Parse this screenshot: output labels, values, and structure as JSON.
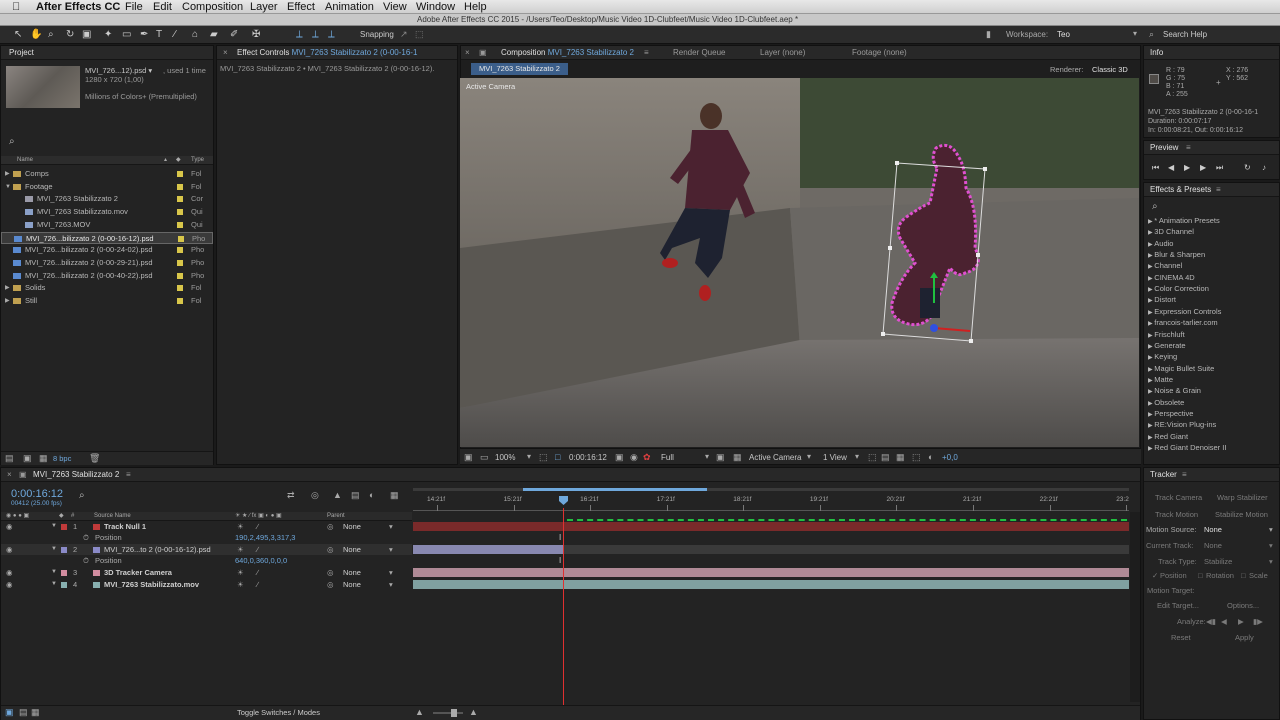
{
  "menubar": {
    "apple": "",
    "app": "After Effects CC",
    "items": [
      "File",
      "Edit",
      "Composition",
      "Layer",
      "Effect",
      "Animation",
      "View",
      "Window",
      "Help"
    ],
    "window_title": "Adobe After Effects CC 2015 - /Users/Teo/Desktop/Music Video 1D-Clubfeet/Music Video 1D-Clubfeet.aep *"
  },
  "toolbar": {
    "snapping": "Snapping",
    "workspace_label": "Workspace:",
    "workspace_value": "Teo",
    "search_help": "Search Help"
  },
  "project": {
    "title": "Project",
    "thumb_name": "MVI_726...12).psd ▾",
    "thumb_used": ", used 1 time",
    "thumb_dims": "1280 x 720 (1,00)",
    "thumb_colors": "Millions of Colors+ (Premultiplied)",
    "col_name": "Name",
    "col_type": "Type",
    "items": [
      {
        "indent": 0,
        "twirl": "▶",
        "icon": "folder",
        "name": "Comps",
        "type": "Fol"
      },
      {
        "indent": 0,
        "twirl": "▼",
        "icon": "folder",
        "name": "Footage",
        "type": "Fol"
      },
      {
        "indent": 1,
        "twirl": "",
        "icon": "comp",
        "name": "MVI_7263 Stabilizzato 2",
        "type": "Cor"
      },
      {
        "indent": 1,
        "twirl": "",
        "icon": "mov",
        "name": "MVI_7263 Stabilizzato.mov",
        "type": "Qui"
      },
      {
        "indent": 1,
        "twirl": "",
        "icon": "mov",
        "name": "MVI_7263.MOV",
        "type": "Qui"
      },
      {
        "indent": 0,
        "twirl": "",
        "icon": "psd",
        "name": "MVI_726...bilizzato 2 (0-00-16-12).psd",
        "type": "Pho",
        "selected": true
      },
      {
        "indent": 0,
        "twirl": "",
        "icon": "psd",
        "name": "MVI_726...bilizzato 2 (0-00-24-02).psd",
        "type": "Pho"
      },
      {
        "indent": 0,
        "twirl": "",
        "icon": "psd",
        "name": "MVI_726...bilizzato 2 (0-00-29-21).psd",
        "type": "Pho"
      },
      {
        "indent": 0,
        "twirl": "",
        "icon": "psd",
        "name": "MVI_726...bilizzato 2 (0-00-40-22).psd",
        "type": "Pho"
      },
      {
        "indent": 0,
        "twirl": "▶",
        "icon": "folder",
        "name": "Solids",
        "type": "Fol"
      },
      {
        "indent": 0,
        "twirl": "▶",
        "icon": "folder",
        "name": "Still",
        "type": "Fol"
      }
    ],
    "bpc": "8 bpc"
  },
  "effect_controls": {
    "tab_label": "Effect Controls",
    "tab_target": "MVI_7263 Stabilizzato 2 (0-00-16-1",
    "path": "MVI_7263 Stabilizzato 2 • MVI_7263 Stabilizzato 2 (0-00-16-12)."
  },
  "composition": {
    "tab_label": "Composition",
    "tab_target": "MVI_7263 Stabilizzato 2",
    "tab_render": "Render Queue",
    "tab_layer": "Layer (none)",
    "tab_footage": "Footage (none)",
    "subtab": "MVI_7263 Stabilizzato 2",
    "renderer_label": "Renderer:",
    "renderer_value": "Classic 3D",
    "viewer_label": "Active Camera",
    "zoom": "100%",
    "timecode": "0:00:16:12",
    "resolution": "Full",
    "camera": "Active Camera",
    "views": "1 View",
    "exposure": "+0,0"
  },
  "info": {
    "title": "Info",
    "r": "R : 79",
    "g": "G : 75",
    "b": "B : 71",
    "a": "A : 255",
    "x": "X : 276",
    "y": "Y : 562",
    "line1": "MVI_7263 Stabilizzato 2 (0-00-16-1",
    "line2": "Duration: 0:00:07:17",
    "line3": "In: 0:00:08:21, Out: 0:00:16:12"
  },
  "preview": {
    "title": "Preview"
  },
  "effects_presets": {
    "title": "Effects & Presets",
    "items": [
      "* Animation Presets",
      "3D Channel",
      "Audio",
      "Blur & Sharpen",
      "Channel",
      "CINEMA 4D",
      "Color Correction",
      "Distort",
      "Expression Controls",
      "francois-tarlier.com",
      "Frischluft",
      "Generate",
      "Keying",
      "Magic Bullet Suite",
      "Matte",
      "Noise & Grain",
      "Obsolete",
      "Perspective",
      "RE:Vision Plug-ins",
      "Red Giant",
      "Red Giant Denoiser II"
    ]
  },
  "timeline": {
    "tab": "MVI_7263 Stabilizzato 2",
    "timecode": "0:00:16:12",
    "frames": "00412 (25.00 fps)",
    "col_source": "Source Name",
    "col_parent": "Parent",
    "ruler": [
      "14:21f",
      "15:21f",
      "16:21f",
      "17:21f",
      "18:21f",
      "19:21f",
      "20:21f",
      "21:21f",
      "22:21f",
      "23:2"
    ],
    "layers": [
      {
        "num": "1",
        "name": "Track Null 1",
        "color": "#c03a3a",
        "parent": "None",
        "prop": "Position",
        "value": "190,2,495,3,317,3"
      },
      {
        "num": "2",
        "name": "MVI_726...to 2 (0-00-16-12).psd",
        "color": "#8b8bc8",
        "parent": "None",
        "prop": "Position",
        "value": "640,0,360,0,0,0"
      },
      {
        "num": "3",
        "name": "3D Tracker Camera",
        "color": "#d28da0",
        "parent": "None"
      },
      {
        "num": "4",
        "name": "MVI_7263 Stabilizzato.mov",
        "color": "#88b0b0",
        "parent": "None"
      }
    ],
    "toggle": "Toggle Switches / Modes"
  },
  "tracker": {
    "title": "Tracker",
    "track_camera": "Track Camera",
    "warp_stabilizer": "Warp Stabilizer",
    "track_motion": "Track Motion",
    "stabilize_motion": "Stabilize Motion",
    "motion_source_label": "Motion Source:",
    "motion_source_value": "None",
    "current_track_label": "Current Track:",
    "current_track_value": "None",
    "track_type_label": "Track Type:",
    "track_type_value": "Stabilize",
    "position": "Position",
    "rotation": "Rotation",
    "scale": "Scale",
    "motion_target": "Motion Target:",
    "edit_target": "Edit Target...",
    "options": "Options...",
    "analyze": "Analyze:",
    "reset": "Reset",
    "apply": "Apply"
  }
}
